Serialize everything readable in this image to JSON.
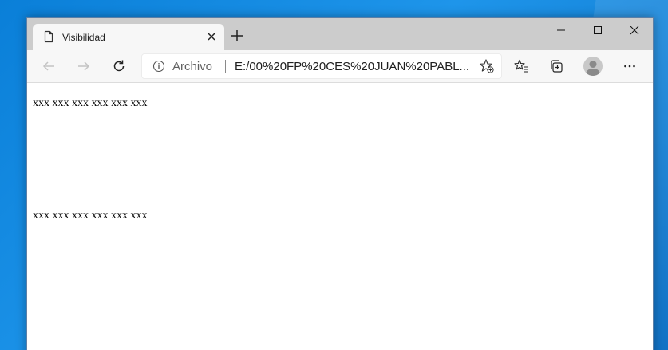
{
  "browser": {
    "tab": {
      "title": "Visibilidad",
      "icon": "page-icon",
      "close_icon": "close-icon"
    },
    "new_tab_icon": "plus-icon",
    "window_controls": [
      "minimize-icon",
      "maximize-icon",
      "close-icon"
    ],
    "toolbar": {
      "back_icon": "back-arrow-icon",
      "forward_icon": "forward-arrow-icon",
      "refresh_icon": "refresh-icon",
      "address": {
        "info_icon": "info-icon",
        "scheme_label": "Archivo",
        "url": "E:/00%20FP%20CES%20JUAN%20PABL...",
        "favorite_icon": "add-favorite-icon"
      },
      "right_icons": [
        "favorites-icon",
        "collections-icon",
        "profile-avatar-icon",
        "more-icon"
      ]
    },
    "colors": {
      "titlebar": "#cccccc",
      "toolbar": "#f7f7f7",
      "desktop": "#1e95ea"
    }
  },
  "page": {
    "paragraphs": [
      "xxx xxx xxx xxx xxx xxx",
      "xxx xxx xxx xxx xxx xxx"
    ]
  }
}
